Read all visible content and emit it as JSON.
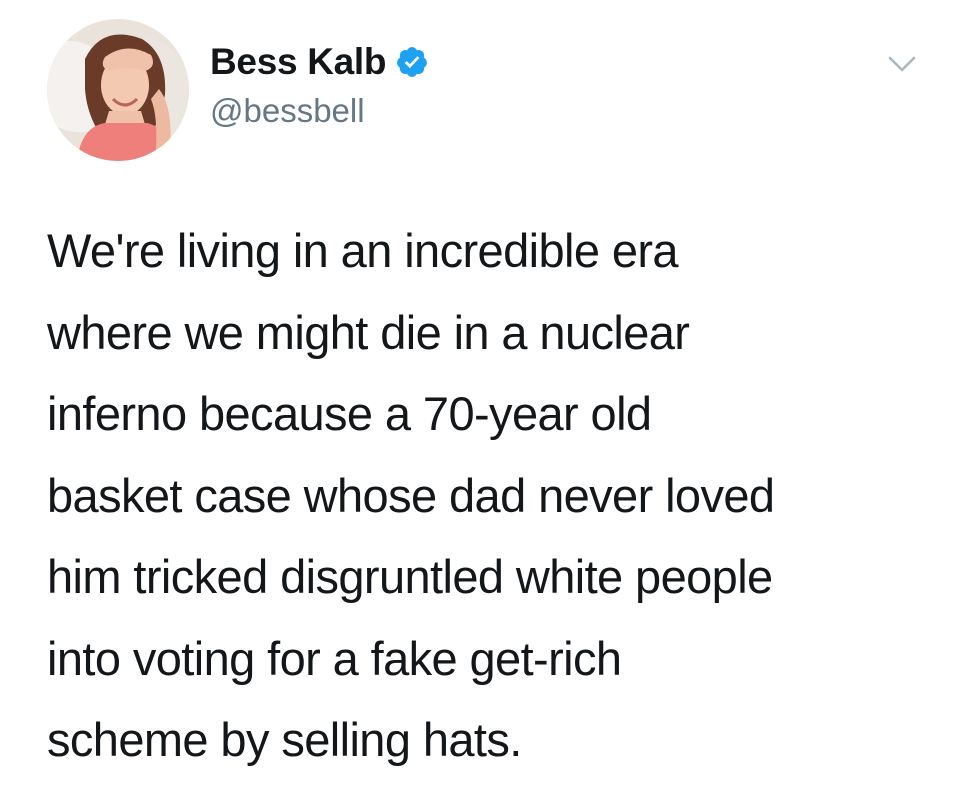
{
  "author": {
    "display_name": "Bess Kalb",
    "handle": "@bessbell",
    "verified": true,
    "avatar_icon": "profile-photo"
  },
  "tweet": {
    "lines": [
      "We're living in an incredible era",
      "where we might die in a nuclear",
      "inferno because a 70-year old",
      "basket case whose dad never loved",
      "him tricked disgruntled white people",
      "into voting for a fake get-rich",
      "scheme by selling hats."
    ]
  },
  "icons": {
    "verified": "verified-badge-icon",
    "menu": "chevron-down-icon"
  },
  "colors": {
    "text": "#14171a",
    "secondary": "#657786",
    "verified": "#1da1f2",
    "caret": "#aab8c2"
  }
}
